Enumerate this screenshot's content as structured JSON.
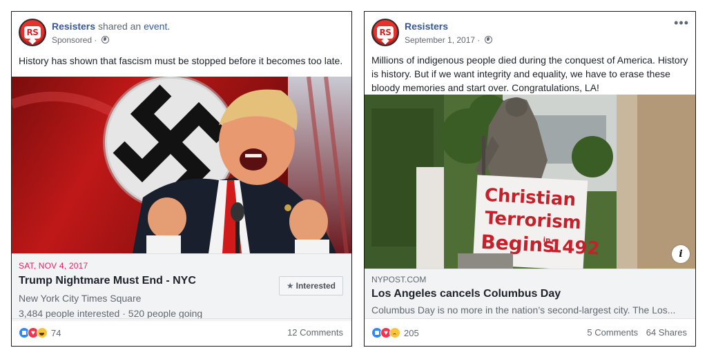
{
  "posts": [
    {
      "page_name": "Resisters",
      "avatar_text": "RS",
      "shared_text": "shared an",
      "shared_link": "event.",
      "sub_label": "Sponsored",
      "sub_sep": "·",
      "body": "History has shown that fascism must be stopped before it becomes too late.",
      "event": {
        "date": "SAT, NOV 4, 2017",
        "title": "Trump Nightmare Must End - NYC",
        "place": "New York City Times Square",
        "stats": "3,484 people interested · 520 people going",
        "interested_star": "★",
        "interested_label": "Interested"
      },
      "reaction_count": "74",
      "comments": "12 Comments"
    },
    {
      "page_name": "Resisters",
      "avatar_text": "RS",
      "date": "September 1, 2017",
      "sub_sep": "·",
      "more": "•••",
      "body": "Millions of indigenous people died during the conquest of America. History is history. But if we want integrity and equality, we have to erase these bloody memories and start over. Congratulations, LA!",
      "sign_lines": [
        "Christian",
        "Terrorism",
        "Begins",
        "in",
        "1492"
      ],
      "info_badge": "i",
      "link": {
        "domain": "NYPOST.COM",
        "title": "Los Angeles cancels Columbus Day",
        "desc": "Columbus Day is no more in the nation’s second-largest city. The Los..."
      },
      "reaction_count": "205",
      "comments": "5 Comments",
      "shares": "64 Shares"
    }
  ],
  "colors": {
    "page_link": "#365899",
    "event_date": "#e0245e",
    "like": "#2d88ff",
    "love": "#f0364f"
  }
}
